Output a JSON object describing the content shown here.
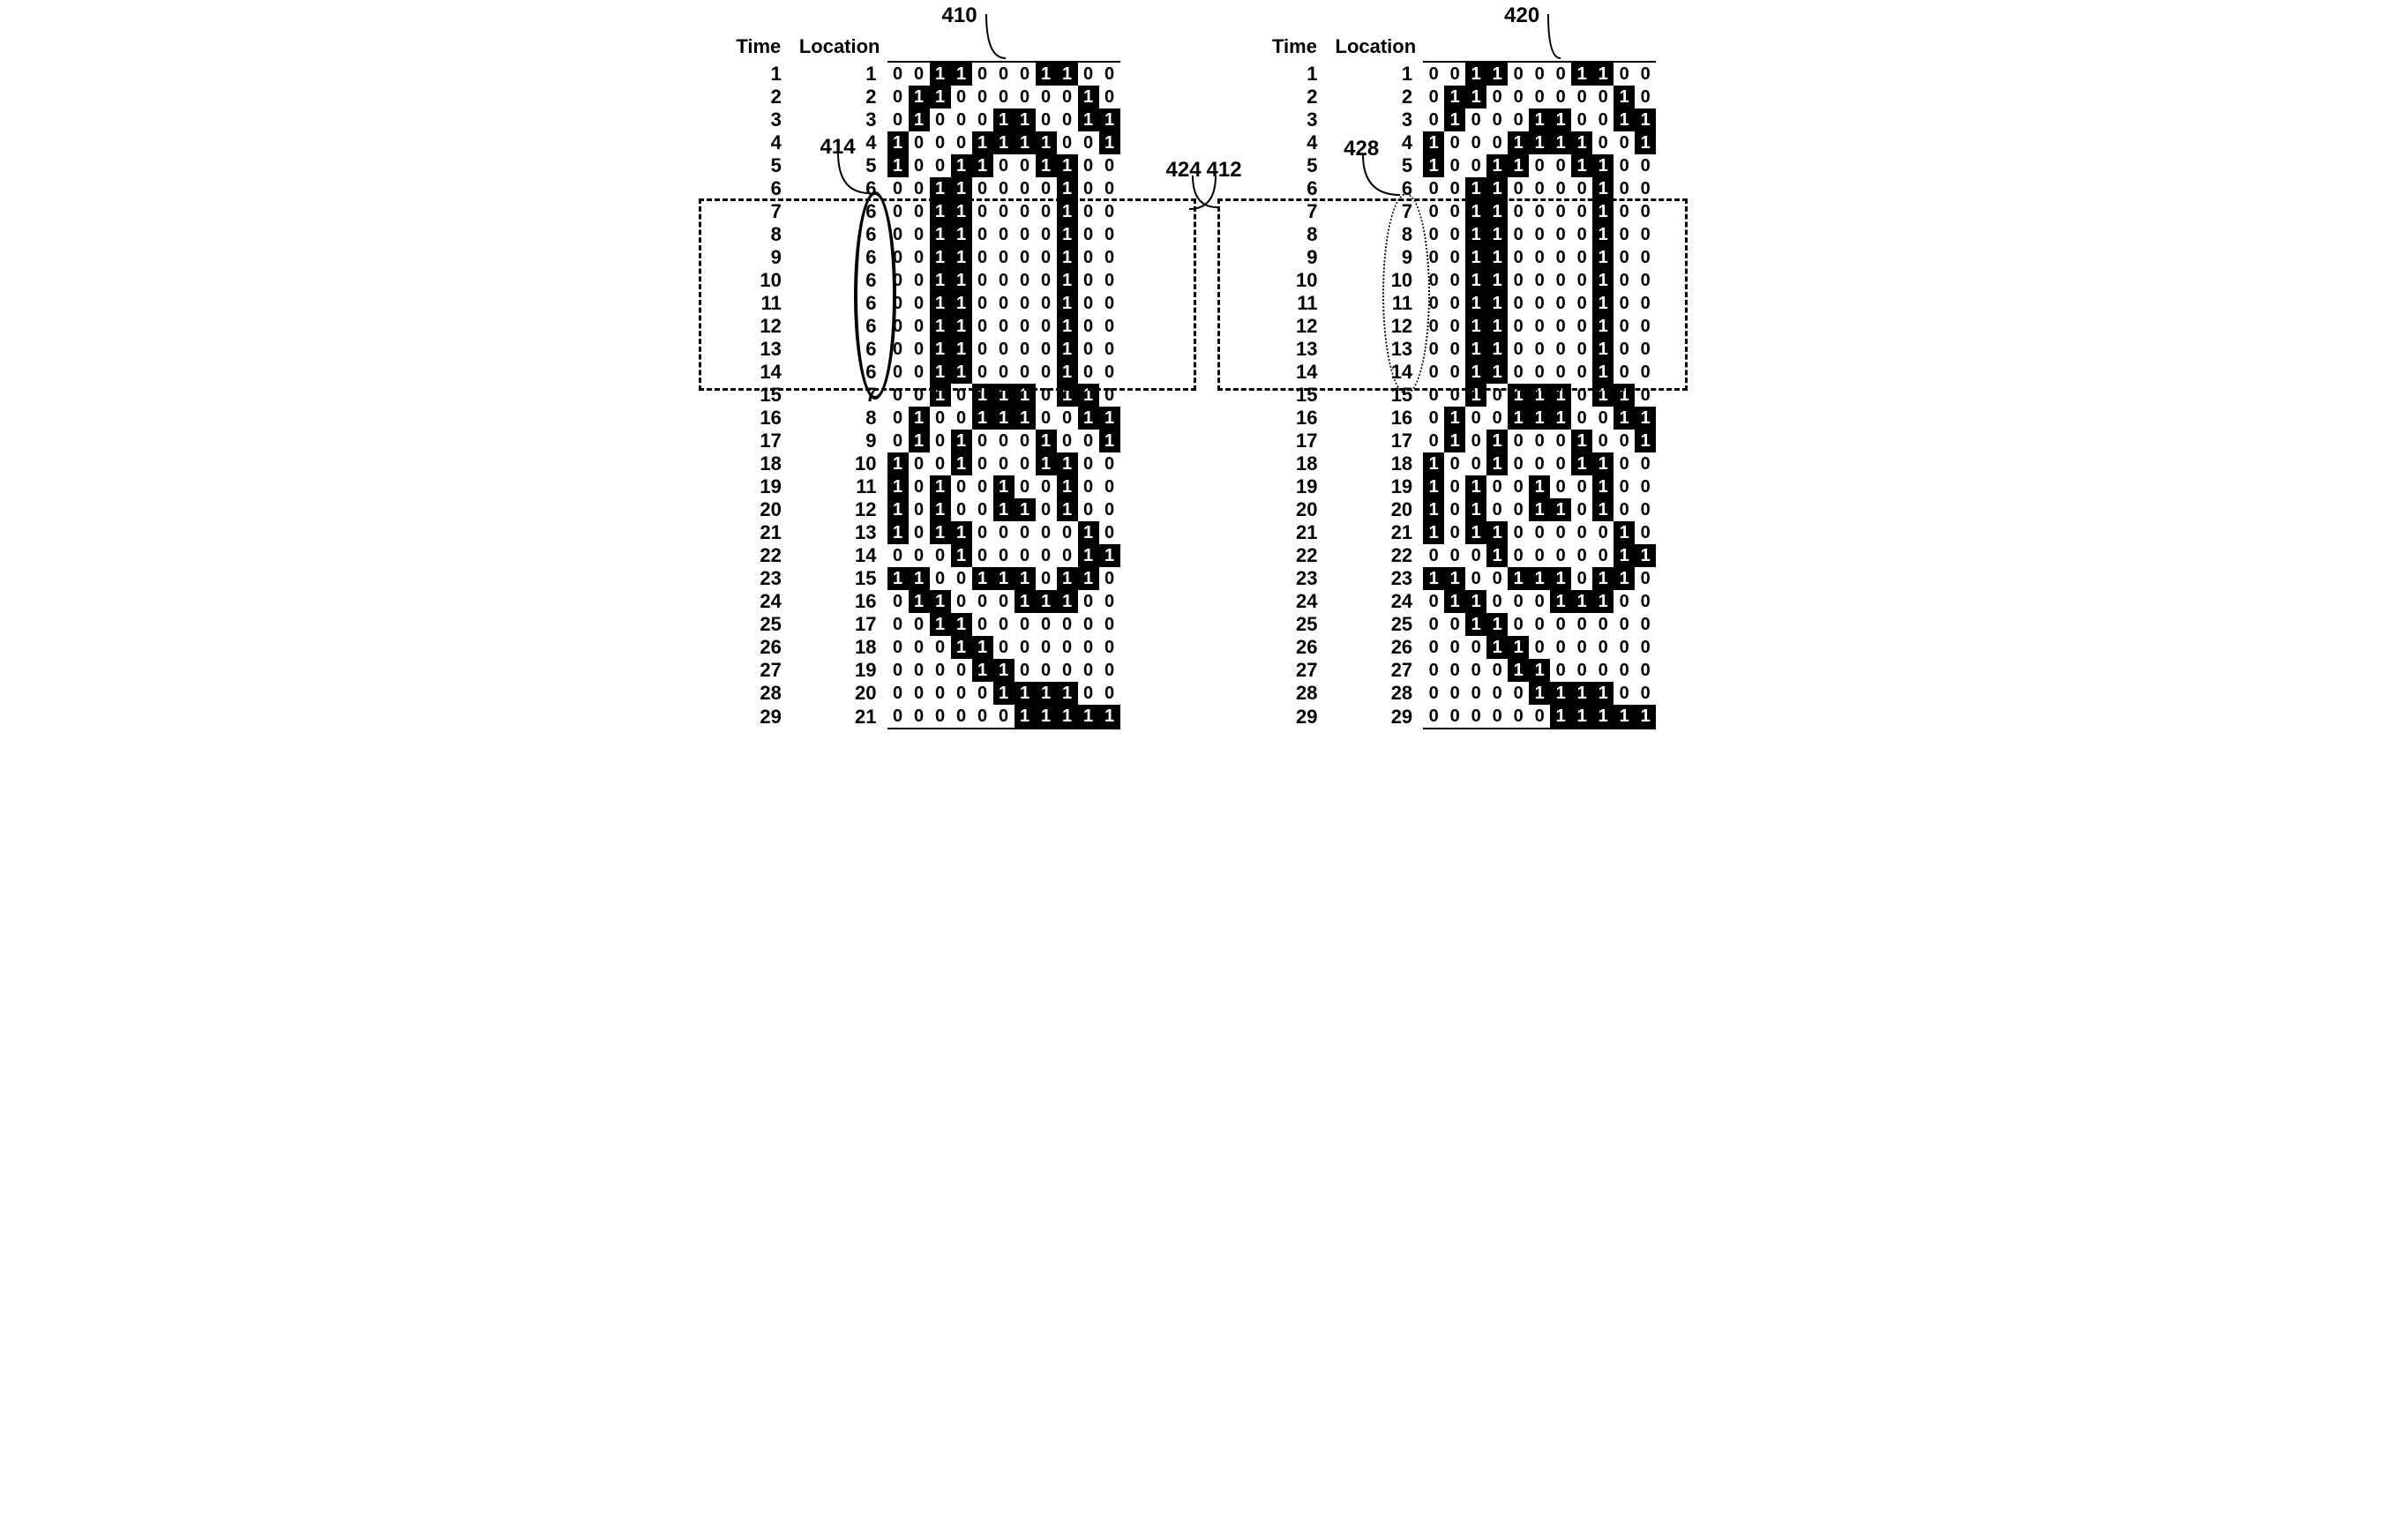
{
  "headers": {
    "time": "Time",
    "location": "Location"
  },
  "refs": {
    "p410": "410",
    "p412": "412",
    "p414": "414",
    "p420": "420",
    "p424": "424",
    "p428": "428"
  },
  "left": {
    "time": [
      1,
      2,
      3,
      4,
      5,
      6,
      7,
      8,
      9,
      10,
      11,
      12,
      13,
      14,
      15,
      16,
      17,
      18,
      19,
      20,
      21,
      22,
      23,
      24,
      25,
      26,
      27,
      28,
      29
    ],
    "location": [
      1,
      2,
      3,
      4,
      5,
      6,
      6,
      6,
      6,
      6,
      6,
      6,
      6,
      6,
      7,
      8,
      9,
      10,
      11,
      12,
      13,
      14,
      15,
      16,
      17,
      18,
      19,
      20,
      21
    ]
  },
  "right": {
    "time": [
      1,
      2,
      3,
      4,
      5,
      6,
      7,
      8,
      9,
      10,
      11,
      12,
      13,
      14,
      15,
      16,
      17,
      18,
      19,
      20,
      21,
      22,
      23,
      24,
      25,
      26,
      27,
      28,
      29
    ],
    "location": [
      1,
      2,
      3,
      4,
      5,
      6,
      7,
      8,
      9,
      10,
      11,
      12,
      13,
      14,
      15,
      16,
      17,
      18,
      19,
      20,
      21,
      22,
      23,
      24,
      25,
      26,
      27,
      28,
      29
    ]
  },
  "matrix": [
    [
      0,
      0,
      1,
      1,
      0,
      0,
      0,
      1,
      1,
      0,
      0
    ],
    [
      0,
      1,
      1,
      0,
      0,
      0,
      0,
      0,
      0,
      1,
      0
    ],
    [
      0,
      1,
      0,
      0,
      0,
      1,
      1,
      0,
      0,
      1,
      1
    ],
    [
      1,
      0,
      0,
      0,
      1,
      1,
      1,
      1,
      0,
      0,
      1
    ],
    [
      1,
      0,
      0,
      1,
      1,
      0,
      0,
      1,
      1,
      0,
      0
    ],
    [
      0,
      0,
      1,
      1,
      0,
      0,
      0,
      0,
      1,
      0,
      0
    ],
    [
      0,
      0,
      1,
      1,
      0,
      0,
      0,
      0,
      1,
      0,
      0
    ],
    [
      0,
      0,
      1,
      1,
      0,
      0,
      0,
      0,
      1,
      0,
      0
    ],
    [
      0,
      0,
      1,
      1,
      0,
      0,
      0,
      0,
      1,
      0,
      0
    ],
    [
      0,
      0,
      1,
      1,
      0,
      0,
      0,
      0,
      1,
      0,
      0
    ],
    [
      0,
      0,
      1,
      1,
      0,
      0,
      0,
      0,
      1,
      0,
      0
    ],
    [
      0,
      0,
      1,
      1,
      0,
      0,
      0,
      0,
      1,
      0,
      0
    ],
    [
      0,
      0,
      1,
      1,
      0,
      0,
      0,
      0,
      1,
      0,
      0
    ],
    [
      0,
      0,
      1,
      1,
      0,
      0,
      0,
      0,
      1,
      0,
      0
    ],
    [
      0,
      0,
      1,
      0,
      1,
      1,
      1,
      0,
      1,
      1,
      0
    ],
    [
      0,
      1,
      0,
      0,
      1,
      1,
      1,
      0,
      0,
      1,
      1
    ],
    [
      0,
      1,
      0,
      1,
      0,
      0,
      0,
      1,
      0,
      0,
      1
    ],
    [
      1,
      0,
      0,
      1,
      0,
      0,
      0,
      1,
      1,
      0,
      0
    ],
    [
      1,
      0,
      1,
      0,
      0,
      1,
      0,
      0,
      1,
      0,
      0
    ],
    [
      1,
      0,
      1,
      0,
      0,
      1,
      1,
      0,
      1,
      0,
      0
    ],
    [
      1,
      0,
      1,
      1,
      0,
      0,
      0,
      0,
      0,
      1,
      0
    ],
    [
      0,
      0,
      0,
      1,
      0,
      0,
      0,
      0,
      0,
      1,
      1
    ],
    [
      1,
      1,
      0,
      0,
      1,
      1,
      1,
      0,
      1,
      1,
      0
    ],
    [
      0,
      1,
      1,
      0,
      0,
      0,
      1,
      1,
      1,
      0,
      0
    ],
    [
      0,
      0,
      1,
      1,
      0,
      0,
      0,
      0,
      0,
      0,
      0
    ],
    [
      0,
      0,
      0,
      1,
      1,
      0,
      0,
      0,
      0,
      0,
      0
    ],
    [
      0,
      0,
      0,
      0,
      1,
      1,
      0,
      0,
      0,
      0,
      0
    ],
    [
      0,
      0,
      0,
      0,
      0,
      1,
      1,
      1,
      1,
      0,
      0
    ],
    [
      0,
      0,
      0,
      0,
      0,
      0,
      1,
      1,
      1,
      1,
      1
    ]
  ]
}
